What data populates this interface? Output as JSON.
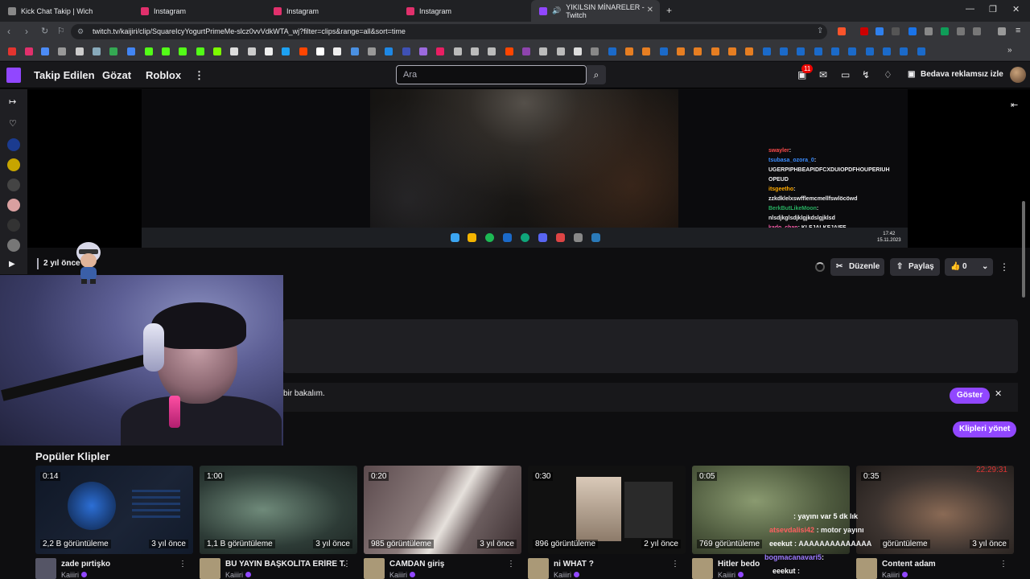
{
  "browser": {
    "tabs": [
      {
        "label": "Kick Chat Takip | Wich",
        "color": "#53fc18"
      },
      {
        "label": "Instagram",
        "color": "#e1306c"
      },
      {
        "label": "Instagram",
        "color": "#e1306c"
      },
      {
        "label": "Instagram",
        "color": "#e1306c"
      },
      {
        "label": "YIKILSIN MİNARELER - Twitch",
        "color": "#9147ff"
      }
    ],
    "new_tab": "+",
    "url": "twitch.tv/kaijiri/clip/SquareIcyYogurtPrimeMe-slcz0vvVdkWTA_wj?filter=clips&range=all&sort=time"
  },
  "twitch_nav": {
    "following": "Takip Edilen",
    "browse": "Gözat",
    "roblox": "Roblox",
    "more": "⋮",
    "search_placeholder": "Ara",
    "notification_count": "11",
    "ad_free": "Bedava reklamsız izle",
    "brand_color": "#9147ff"
  },
  "stream_overlay": {
    "chat": [
      {
        "user": "swayler",
        "text": ":",
        "color": "#ff4b4b"
      },
      {
        "user": "tsubasa_ozora_0",
        "text": ":",
        "color": "#3b8dff"
      },
      {
        "user": "",
        "text": "UGERPIPHBEAPIDFCXDUIOPDFHOUPERIUH",
        "color": "#ffffff"
      },
      {
        "user": "",
        "text": "OPEUD",
        "color": "#ffffff"
      },
      {
        "user": "itsgeetho",
        "text": ":",
        "color": "#ffaa00"
      },
      {
        "user": "",
        "text": "zzkdklelxswfflemcmellfswlöcöwd",
        "color": "#ffffff"
      },
      {
        "user": "BerkButLikeMoon",
        "text": ":",
        "color": "#27ae60"
      },
      {
        "user": "",
        "text": "nlsdjkglsdjklgjkdslgjklsd",
        "color": "#ffffff"
      },
      {
        "user": "kado_chan",
        "text": ": KLFJALKFJAIFF",
        "color": "#ff5fae"
      }
    ],
    "clock_time": "17:42",
    "clock_date": "15.11.2023"
  },
  "clip_meta": {
    "time_ago": "2 yıl önce",
    "edit": "Düzenle",
    "share": "Paylaş",
    "likes": "0"
  },
  "notice": {
    "text": "bir bakalım.",
    "show": "Göster",
    "close": "✕"
  },
  "manage_clips": "Klipleri yönet",
  "popular": {
    "title": "Popüler Klipler",
    "clips": [
      {
        "duration": "0:14",
        "views": "2,2 B görüntüleme",
        "age": "3 yıl önce",
        "title": "zade pırtişko",
        "author": "Kaiiiri"
      },
      {
        "duration": "1:00",
        "views": "1,1 B görüntüleme",
        "age": "3 yıl önce",
        "title": "BU YAYIN BAŞKOLİTA ERİRE T...",
        "author": "Kaiiiri"
      },
      {
        "duration": "0:20",
        "views": "985 görüntüleme",
        "age": "3 yıl önce",
        "title": "CAMDAN giriş",
        "author": "Kaiiiri"
      },
      {
        "duration": "0:30",
        "views": "896 görüntüleme",
        "age": "2 yıl önce",
        "title": "ni WHAT ?",
        "author": "Kaiiiri"
      },
      {
        "duration": "0:05",
        "views": "769 görüntüleme",
        "age": "3 yıl önce",
        "title": "Hitler bedo",
        "author": "Kaiiiri"
      },
      {
        "duration": "0:35",
        "views": "görüntüleme",
        "age": "3 yıl önce",
        "title": "Content adam",
        "author": "Kaiiiri"
      }
    ]
  },
  "bottom_chat": [
    {
      "user": "",
      "text": ": yayını var 5 dk lık",
      "color": "#ffffff"
    },
    {
      "user": "atsevdalisi42",
      "text": ": motor yayını",
      "color": "#ff5f5f"
    },
    {
      "user": "eeekut",
      "text": ": AAAAAAAAAAAAAA",
      "color": "#ffffff"
    },
    {
      "user": "bogmacanavari5",
      "text": ":",
      "color": "#9d7bff"
    },
    {
      "user": "eeekut",
      "text": ":",
      "color": "#ffffff"
    }
  ],
  "corner_timestamp": "22:29:31"
}
